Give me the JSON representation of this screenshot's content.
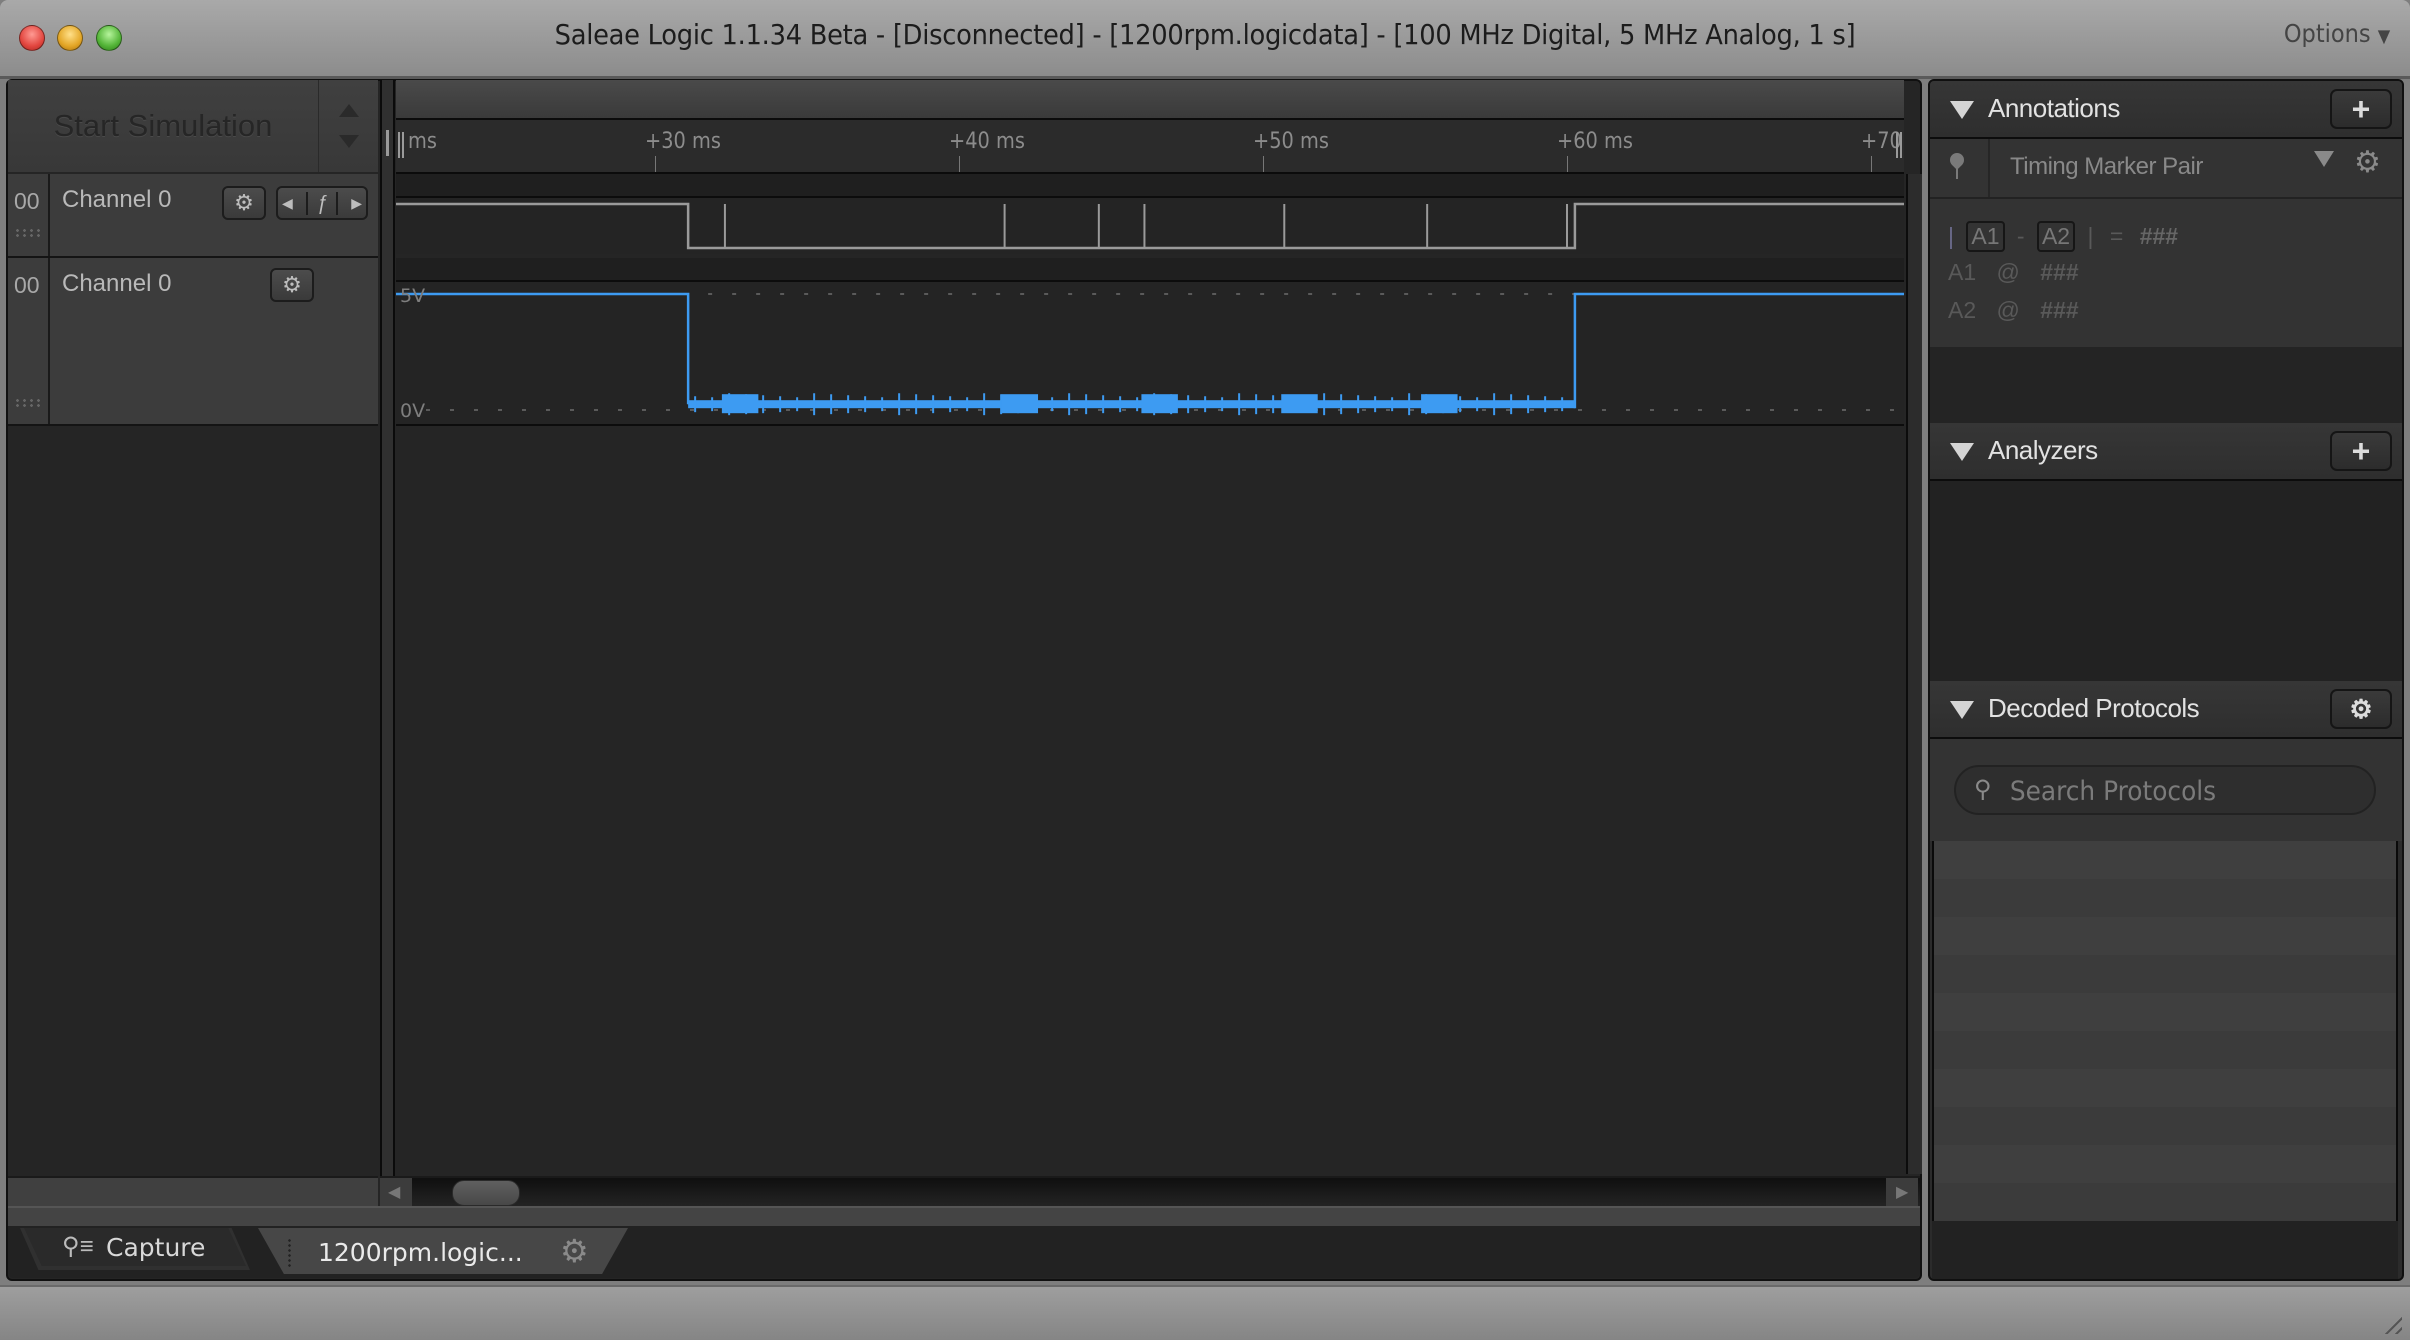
{
  "window": {
    "title": "Saleae Logic 1.1.34 Beta - [Disconnected] - [1200rpm.logicdata] - [100 MHz Digital, 5 MHz Analog, 1 s]",
    "options_label": "Options",
    "options_icon": "triangle-down-icon"
  },
  "simulation": {
    "start_label": "Start Simulation"
  },
  "timeline": {
    "tick_labels": [
      "ms",
      "+30 ms",
      "+40 ms",
      "+50 ms",
      "+60 ms",
      "+70"
    ],
    "tick_times_ms": [
      null,
      30,
      40,
      50,
      60,
      70
    ],
    "unit": "ms"
  },
  "channels": [
    {
      "index": "00",
      "name": "Channel 0",
      "type": "digital",
      "buttons": [
        "gear-icon",
        "prev-edge-icon",
        "trigger-edge-icon",
        "next-edge-icon"
      ],
      "initial_level": "high",
      "edges_ms": [
        31.09,
        32.3,
        32.3,
        41.5,
        41.5,
        44.6,
        44.6,
        46.1,
        46.1,
        50.7,
        50.7,
        55.4,
        55.4,
        60.0,
        60.0,
        60.26
      ],
      "glitches_ms": [
        32.3,
        41.5,
        44.6,
        46.1,
        50.7,
        55.4,
        60.0
      ],
      "low_start_ms": 31.09,
      "low_end_ms": 60.26,
      "trace_color": "#9a9a9a"
    },
    {
      "index": "00",
      "name": "Channel 0",
      "type": "analog",
      "buttons": [
        "gear-icon"
      ],
      "vmax_label": "5V",
      "vmin_label": "0V",
      "vmax": 5,
      "vmin": 0,
      "high_volts": 5,
      "low_volts": 0.25,
      "fall_ms": 31.09,
      "rise_ms": 60.26,
      "noise_bursts_ms": [
        [
          32.2,
          33.4
        ],
        [
          41.4,
          42.6
        ],
        [
          46.0,
          47.2
        ],
        [
          50.6,
          51.8
        ],
        [
          55.2,
          56.4
        ]
      ],
      "trace_color": "#3d9bf2"
    }
  ],
  "right_panel": {
    "annotations": {
      "title": "Annotations",
      "add_icon": "plus-icon",
      "marker_type": "Timing Marker Pair",
      "formula": {
        "bar_left": "|",
        "a1": "A1",
        "minus": "-",
        "a2": "A2",
        "bar_right": "|",
        "equals": "=",
        "value": "###"
      },
      "rows": [
        {
          "label": "A1",
          "at": "@",
          "value": "###"
        },
        {
          "label": "A2",
          "at": "@",
          "value": "###"
        }
      ]
    },
    "analyzers": {
      "title": "Analyzers",
      "add_icon": "plus-icon"
    },
    "decoded_protocols": {
      "title": "Decoded Protocols",
      "settings_icon": "gear-icon",
      "search_placeholder": "Search Protocols",
      "search_value": ""
    }
  },
  "bottom_tabs": {
    "capture_label": "Capture",
    "file_label": "1200rpm.logic..."
  }
}
